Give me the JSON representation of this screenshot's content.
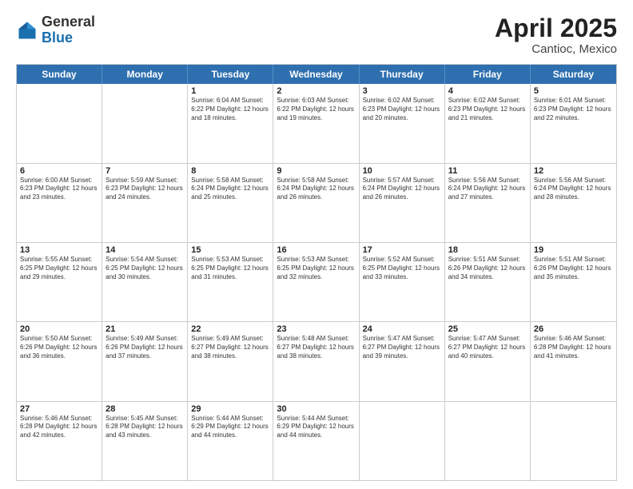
{
  "logo": {
    "general": "General",
    "blue": "Blue"
  },
  "title": {
    "month": "April 2025",
    "location": "Cantioc, Mexico"
  },
  "header_days": [
    "Sunday",
    "Monday",
    "Tuesday",
    "Wednesday",
    "Thursday",
    "Friday",
    "Saturday"
  ],
  "weeks": [
    [
      {
        "day": "",
        "info": ""
      },
      {
        "day": "",
        "info": ""
      },
      {
        "day": "1",
        "info": "Sunrise: 6:04 AM\nSunset: 6:22 PM\nDaylight: 12 hours and 18 minutes."
      },
      {
        "day": "2",
        "info": "Sunrise: 6:03 AM\nSunset: 6:22 PM\nDaylight: 12 hours and 19 minutes."
      },
      {
        "day": "3",
        "info": "Sunrise: 6:02 AM\nSunset: 6:23 PM\nDaylight: 12 hours and 20 minutes."
      },
      {
        "day": "4",
        "info": "Sunrise: 6:02 AM\nSunset: 6:23 PM\nDaylight: 12 hours and 21 minutes."
      },
      {
        "day": "5",
        "info": "Sunrise: 6:01 AM\nSunset: 6:23 PM\nDaylight: 12 hours and 22 minutes."
      }
    ],
    [
      {
        "day": "6",
        "info": "Sunrise: 6:00 AM\nSunset: 6:23 PM\nDaylight: 12 hours and 23 minutes."
      },
      {
        "day": "7",
        "info": "Sunrise: 5:59 AM\nSunset: 6:23 PM\nDaylight: 12 hours and 24 minutes."
      },
      {
        "day": "8",
        "info": "Sunrise: 5:58 AM\nSunset: 6:24 PM\nDaylight: 12 hours and 25 minutes."
      },
      {
        "day": "9",
        "info": "Sunrise: 5:58 AM\nSunset: 6:24 PM\nDaylight: 12 hours and 26 minutes."
      },
      {
        "day": "10",
        "info": "Sunrise: 5:57 AM\nSunset: 6:24 PM\nDaylight: 12 hours and 26 minutes."
      },
      {
        "day": "11",
        "info": "Sunrise: 5:56 AM\nSunset: 6:24 PM\nDaylight: 12 hours and 27 minutes."
      },
      {
        "day": "12",
        "info": "Sunrise: 5:56 AM\nSunset: 6:24 PM\nDaylight: 12 hours and 28 minutes."
      }
    ],
    [
      {
        "day": "13",
        "info": "Sunrise: 5:55 AM\nSunset: 6:25 PM\nDaylight: 12 hours and 29 minutes."
      },
      {
        "day": "14",
        "info": "Sunrise: 5:54 AM\nSunset: 6:25 PM\nDaylight: 12 hours and 30 minutes."
      },
      {
        "day": "15",
        "info": "Sunrise: 5:53 AM\nSunset: 6:25 PM\nDaylight: 12 hours and 31 minutes."
      },
      {
        "day": "16",
        "info": "Sunrise: 5:53 AM\nSunset: 6:25 PM\nDaylight: 12 hours and 32 minutes."
      },
      {
        "day": "17",
        "info": "Sunrise: 5:52 AM\nSunset: 6:25 PM\nDaylight: 12 hours and 33 minutes."
      },
      {
        "day": "18",
        "info": "Sunrise: 5:51 AM\nSunset: 6:26 PM\nDaylight: 12 hours and 34 minutes."
      },
      {
        "day": "19",
        "info": "Sunrise: 5:51 AM\nSunset: 6:26 PM\nDaylight: 12 hours and 35 minutes."
      }
    ],
    [
      {
        "day": "20",
        "info": "Sunrise: 5:50 AM\nSunset: 6:26 PM\nDaylight: 12 hours and 36 minutes."
      },
      {
        "day": "21",
        "info": "Sunrise: 5:49 AM\nSunset: 6:26 PM\nDaylight: 12 hours and 37 minutes."
      },
      {
        "day": "22",
        "info": "Sunrise: 5:49 AM\nSunset: 6:27 PM\nDaylight: 12 hours and 38 minutes."
      },
      {
        "day": "23",
        "info": "Sunrise: 5:48 AM\nSunset: 6:27 PM\nDaylight: 12 hours and 38 minutes."
      },
      {
        "day": "24",
        "info": "Sunrise: 5:47 AM\nSunset: 6:27 PM\nDaylight: 12 hours and 39 minutes."
      },
      {
        "day": "25",
        "info": "Sunrise: 5:47 AM\nSunset: 6:27 PM\nDaylight: 12 hours and 40 minutes."
      },
      {
        "day": "26",
        "info": "Sunrise: 5:46 AM\nSunset: 6:28 PM\nDaylight: 12 hours and 41 minutes."
      }
    ],
    [
      {
        "day": "27",
        "info": "Sunrise: 5:46 AM\nSunset: 6:28 PM\nDaylight: 12 hours and 42 minutes."
      },
      {
        "day": "28",
        "info": "Sunrise: 5:45 AM\nSunset: 6:28 PM\nDaylight: 12 hours and 43 minutes."
      },
      {
        "day": "29",
        "info": "Sunrise: 5:44 AM\nSunset: 6:29 PM\nDaylight: 12 hours and 44 minutes."
      },
      {
        "day": "30",
        "info": "Sunrise: 5:44 AM\nSunset: 6:29 PM\nDaylight: 12 hours and 44 minutes."
      },
      {
        "day": "",
        "info": ""
      },
      {
        "day": "",
        "info": ""
      },
      {
        "day": "",
        "info": ""
      }
    ]
  ]
}
